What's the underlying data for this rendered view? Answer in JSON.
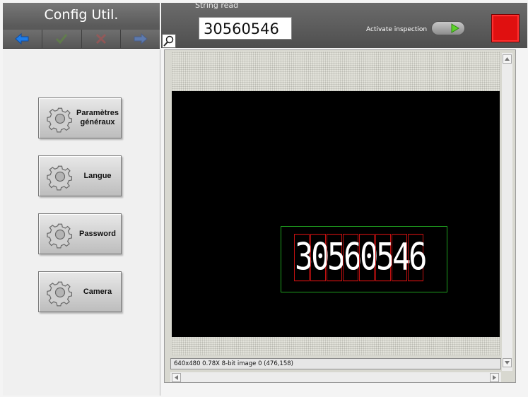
{
  "header": {
    "title": "Config Util.",
    "nav": [
      {
        "name": "back-arrow-icon",
        "color": "#1f7de8"
      },
      {
        "name": "check-icon",
        "color": "#6aaa3a"
      },
      {
        "name": "close-x-icon",
        "color": "#c85a5a"
      },
      {
        "name": "forward-arrow-icon",
        "color": "#5a8ae0"
      }
    ]
  },
  "topbar": {
    "string_read_label": "String read",
    "string_read_value": "30560546",
    "activate_label": "Activate inspection",
    "indicator_color": "#e01010"
  },
  "menu": {
    "items": [
      {
        "label": "Paramètres généraux"
      },
      {
        "label": "Langue"
      },
      {
        "label": "Password"
      },
      {
        "label": "Camera"
      }
    ]
  },
  "viewer": {
    "ocr_chars": [
      "3",
      "0",
      "5",
      "6",
      "0",
      "5",
      "4",
      "6"
    ],
    "status": "640x480 0.78X 8-bit image 0    (476,158)"
  }
}
